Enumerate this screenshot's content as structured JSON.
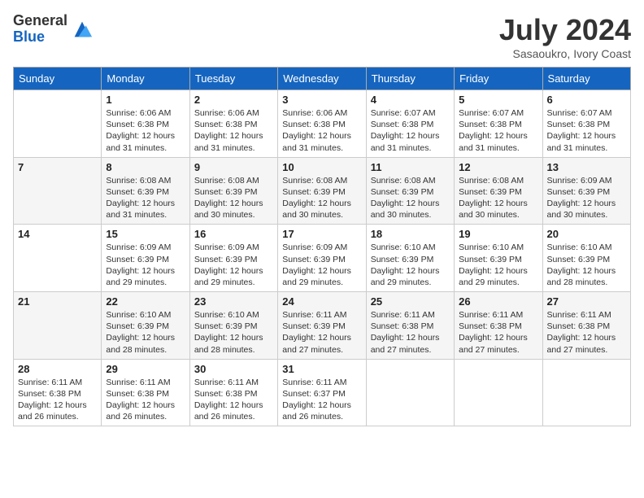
{
  "header": {
    "logo_general": "General",
    "logo_blue": "Blue",
    "title": "July 2024",
    "subtitle": "Sasaoukro, Ivory Coast"
  },
  "calendar": {
    "days_of_week": [
      "Sunday",
      "Monday",
      "Tuesday",
      "Wednesday",
      "Thursday",
      "Friday",
      "Saturday"
    ],
    "weeks": [
      [
        {
          "day": "",
          "info": ""
        },
        {
          "day": "1",
          "info": "Sunrise: 6:06 AM\nSunset: 6:38 PM\nDaylight: 12 hours and 31 minutes."
        },
        {
          "day": "2",
          "info": "Sunrise: 6:06 AM\nSunset: 6:38 PM\nDaylight: 12 hours and 31 minutes."
        },
        {
          "day": "3",
          "info": "Sunrise: 6:06 AM\nSunset: 6:38 PM\nDaylight: 12 hours and 31 minutes."
        },
        {
          "day": "4",
          "info": "Sunrise: 6:07 AM\nSunset: 6:38 PM\nDaylight: 12 hours and 31 minutes."
        },
        {
          "day": "5",
          "info": "Sunrise: 6:07 AM\nSunset: 6:38 PM\nDaylight: 12 hours and 31 minutes."
        },
        {
          "day": "6",
          "info": "Sunrise: 6:07 AM\nSunset: 6:38 PM\nDaylight: 12 hours and 31 minutes."
        }
      ],
      [
        {
          "day": "7",
          "info": ""
        },
        {
          "day": "8",
          "info": "Sunrise: 6:08 AM\nSunset: 6:39 PM\nDaylight: 12 hours and 31 minutes."
        },
        {
          "day": "9",
          "info": "Sunrise: 6:08 AM\nSunset: 6:39 PM\nDaylight: 12 hours and 30 minutes."
        },
        {
          "day": "10",
          "info": "Sunrise: 6:08 AM\nSunset: 6:39 PM\nDaylight: 12 hours and 30 minutes."
        },
        {
          "day": "11",
          "info": "Sunrise: 6:08 AM\nSunset: 6:39 PM\nDaylight: 12 hours and 30 minutes."
        },
        {
          "day": "12",
          "info": "Sunrise: 6:08 AM\nSunset: 6:39 PM\nDaylight: 12 hours and 30 minutes."
        },
        {
          "day": "13",
          "info": "Sunrise: 6:09 AM\nSunset: 6:39 PM\nDaylight: 12 hours and 30 minutes."
        }
      ],
      [
        {
          "day": "14",
          "info": ""
        },
        {
          "day": "15",
          "info": "Sunrise: 6:09 AM\nSunset: 6:39 PM\nDaylight: 12 hours and 29 minutes."
        },
        {
          "day": "16",
          "info": "Sunrise: 6:09 AM\nSunset: 6:39 PM\nDaylight: 12 hours and 29 minutes."
        },
        {
          "day": "17",
          "info": "Sunrise: 6:09 AM\nSunset: 6:39 PM\nDaylight: 12 hours and 29 minutes."
        },
        {
          "day": "18",
          "info": "Sunrise: 6:10 AM\nSunset: 6:39 PM\nDaylight: 12 hours and 29 minutes."
        },
        {
          "day": "19",
          "info": "Sunrise: 6:10 AM\nSunset: 6:39 PM\nDaylight: 12 hours and 29 minutes."
        },
        {
          "day": "20",
          "info": "Sunrise: 6:10 AM\nSunset: 6:39 PM\nDaylight: 12 hours and 28 minutes."
        }
      ],
      [
        {
          "day": "21",
          "info": ""
        },
        {
          "day": "22",
          "info": "Sunrise: 6:10 AM\nSunset: 6:39 PM\nDaylight: 12 hours and 28 minutes."
        },
        {
          "day": "23",
          "info": "Sunrise: 6:10 AM\nSunset: 6:39 PM\nDaylight: 12 hours and 28 minutes."
        },
        {
          "day": "24",
          "info": "Sunrise: 6:11 AM\nSunset: 6:39 PM\nDaylight: 12 hours and 27 minutes."
        },
        {
          "day": "25",
          "info": "Sunrise: 6:11 AM\nSunset: 6:38 PM\nDaylight: 12 hours and 27 minutes."
        },
        {
          "day": "26",
          "info": "Sunrise: 6:11 AM\nSunset: 6:38 PM\nDaylight: 12 hours and 27 minutes."
        },
        {
          "day": "27",
          "info": "Sunrise: 6:11 AM\nSunset: 6:38 PM\nDaylight: 12 hours and 27 minutes."
        }
      ],
      [
        {
          "day": "28",
          "info": "Sunrise: 6:11 AM\nSunset: 6:38 PM\nDaylight: 12 hours and 26 minutes."
        },
        {
          "day": "29",
          "info": "Sunrise: 6:11 AM\nSunset: 6:38 PM\nDaylight: 12 hours and 26 minutes."
        },
        {
          "day": "30",
          "info": "Sunrise: 6:11 AM\nSunset: 6:38 PM\nDaylight: 12 hours and 26 minutes."
        },
        {
          "day": "31",
          "info": "Sunrise: 6:11 AM\nSunset: 6:37 PM\nDaylight: 12 hours and 26 minutes."
        },
        {
          "day": "",
          "info": ""
        },
        {
          "day": "",
          "info": ""
        },
        {
          "day": "",
          "info": ""
        }
      ]
    ]
  }
}
